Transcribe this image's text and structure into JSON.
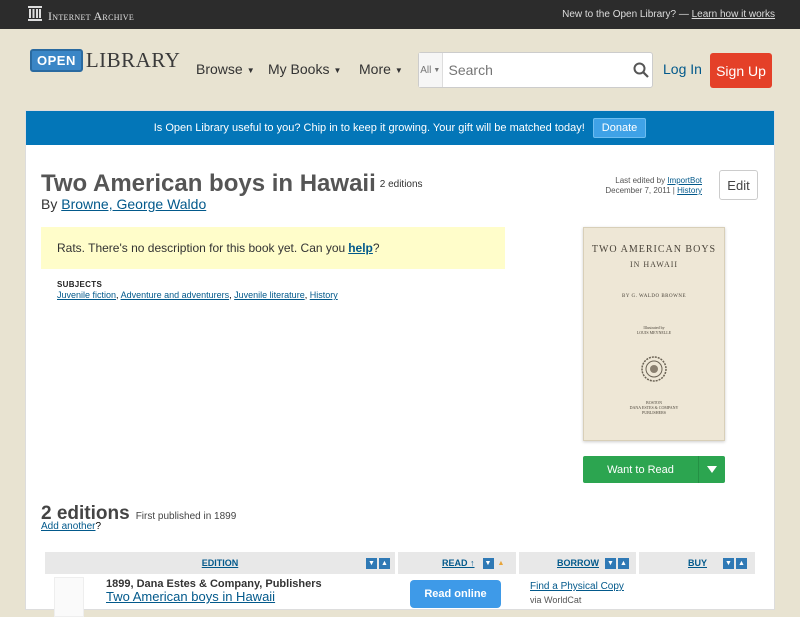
{
  "ia_bar": {
    "logo_text": "Internet Archive",
    "promo_text": "New to the Open Library? —",
    "promo_link": "Learn how it works"
  },
  "header": {
    "logo_badge": "OPEN",
    "logo_word": "LIBRARY",
    "nav": [
      {
        "label": "Browse"
      },
      {
        "label": "My Books"
      },
      {
        "label": "More"
      }
    ],
    "search": {
      "category": "All",
      "placeholder": "Search"
    },
    "login": "Log In",
    "signup": "Sign Up"
  },
  "donate_banner": {
    "text": "Is Open Library useful to you? Chip in to keep it growing. Your gift will be matched today!",
    "button": "Donate"
  },
  "book": {
    "title": "Two American boys in Hawaii",
    "editions_count": "2 editions",
    "by": "By",
    "author": "Browne, George Waldo",
    "last_edited_label": "Last edited by",
    "last_edited_user": "ImportBot",
    "last_edited_date": "December 7, 2011 |",
    "history_link": "History",
    "edit_button": "Edit",
    "description_text": "Rats. There's no description for this book yet. Can you",
    "description_link": "help",
    "description_end": "?",
    "subjects_label": "SUBJECTS",
    "subjects": [
      "Juvenile fiction",
      "Adventure and adventurers",
      "Juvenile literature",
      "History"
    ],
    "cover": {
      "line1": "TWO AMERICAN BOYS",
      "line2": "IN HAWAII",
      "author": "BY G. WALDO BROWNE",
      "illustrated": "Illustrated by",
      "illustrator": "LOUIS MEYNELLE",
      "publisher": [
        "BOSTON",
        "DANA ESTES & COMPANY",
        "PUBLISHERS"
      ]
    },
    "want_to_read": "Want to Read"
  },
  "editions": {
    "heading": "2 editions",
    "first_published": "First published in 1899",
    "add_another": "Add another",
    "add_another_end": "?",
    "columns": {
      "edition": "EDITION",
      "read": "READ ↑",
      "borrow": "BORROW",
      "buy": "BUY"
    },
    "rows": [
      {
        "publisher": "1899, Dana Estes & Company, Publishers",
        "title": "Two American boys in Hawaii",
        "read_button": "Read online",
        "borrow_link": "Find a Physical Copy",
        "via": "via WorldCat"
      }
    ]
  },
  "colors": {
    "accent": "#0376b8",
    "signup": "#e44028",
    "want_to_read": "#2ca550",
    "read_button": "#3e9ae8",
    "notice": "#fffdca"
  }
}
